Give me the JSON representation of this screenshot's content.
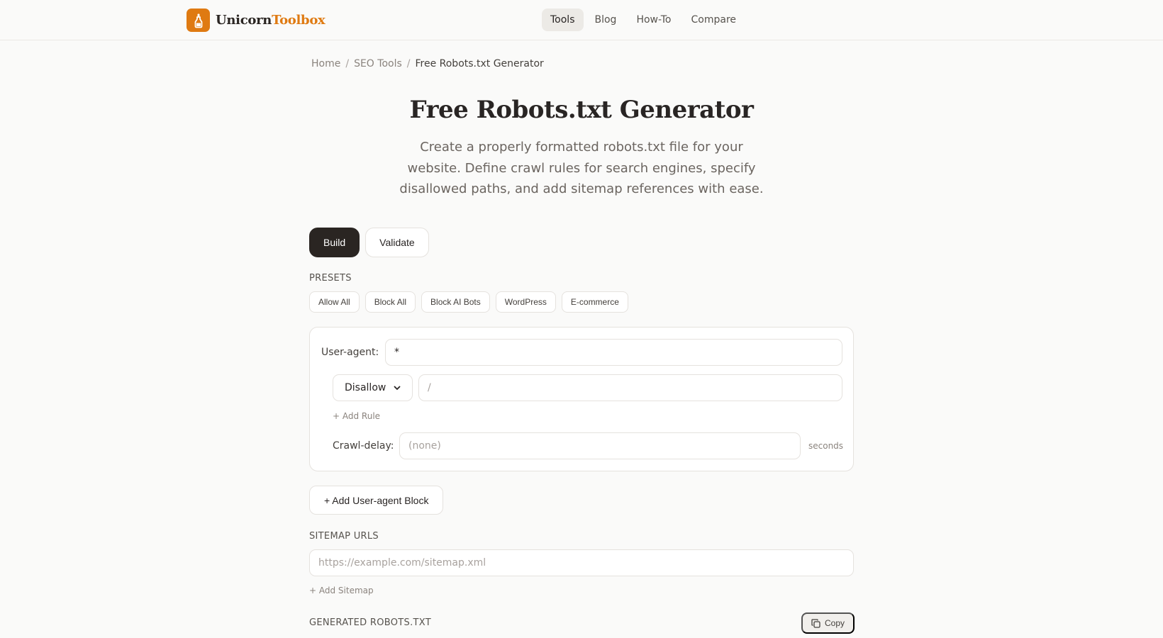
{
  "header": {
    "logo_primary": "Unicorn",
    "logo_accent": "Toolbox",
    "nav": [
      {
        "label": "Tools",
        "active": true
      },
      {
        "label": "Blog",
        "active": false
      },
      {
        "label": "How-To",
        "active": false
      },
      {
        "label": "Compare",
        "active": false
      }
    ]
  },
  "breadcrumb": {
    "items": [
      "Home",
      "SEO Tools"
    ],
    "separator": "/",
    "current": "Free Robots.txt Generator"
  },
  "page": {
    "title": "Free Robots.txt Generator",
    "subtitle": "Create a properly formatted robots.txt file for your website. Define crawl rules for search engines, specify disallowed paths, and add sitemap references with ease."
  },
  "tabs": [
    {
      "label": "Build",
      "active": true
    },
    {
      "label": "Validate",
      "active": false
    }
  ],
  "presets": {
    "label": "PRESETS",
    "items": [
      "Allow All",
      "Block All",
      "Block AI Bots",
      "WordPress",
      "E-commerce"
    ]
  },
  "agent_block": {
    "user_agent_label": "User-agent:",
    "user_agent_value": "*",
    "rule_type": "Disallow",
    "rule_path_placeholder": "/",
    "add_rule_label": "+ Add Rule",
    "crawl_delay_label": "Crawl-delay:",
    "crawl_delay_placeholder": "(none)",
    "crawl_delay_suffix": "seconds"
  },
  "add_block_label": "+ Add User-agent Block",
  "sitemaps": {
    "label": "SITEMAP URLS",
    "placeholder": "https://example.com/sitemap.xml",
    "add_label": "+ Add Sitemap"
  },
  "output": {
    "label": "GENERATED ROBOTS.TXT",
    "copy_label": "Copy"
  },
  "colors": {
    "brand": "#df7a12",
    "dark": "#2a2522",
    "background": "#fafaf9"
  },
  "icons": {
    "logo": "bottle-icon",
    "copy": "copy-icon",
    "select_arrow": "chevron-down-icon"
  }
}
